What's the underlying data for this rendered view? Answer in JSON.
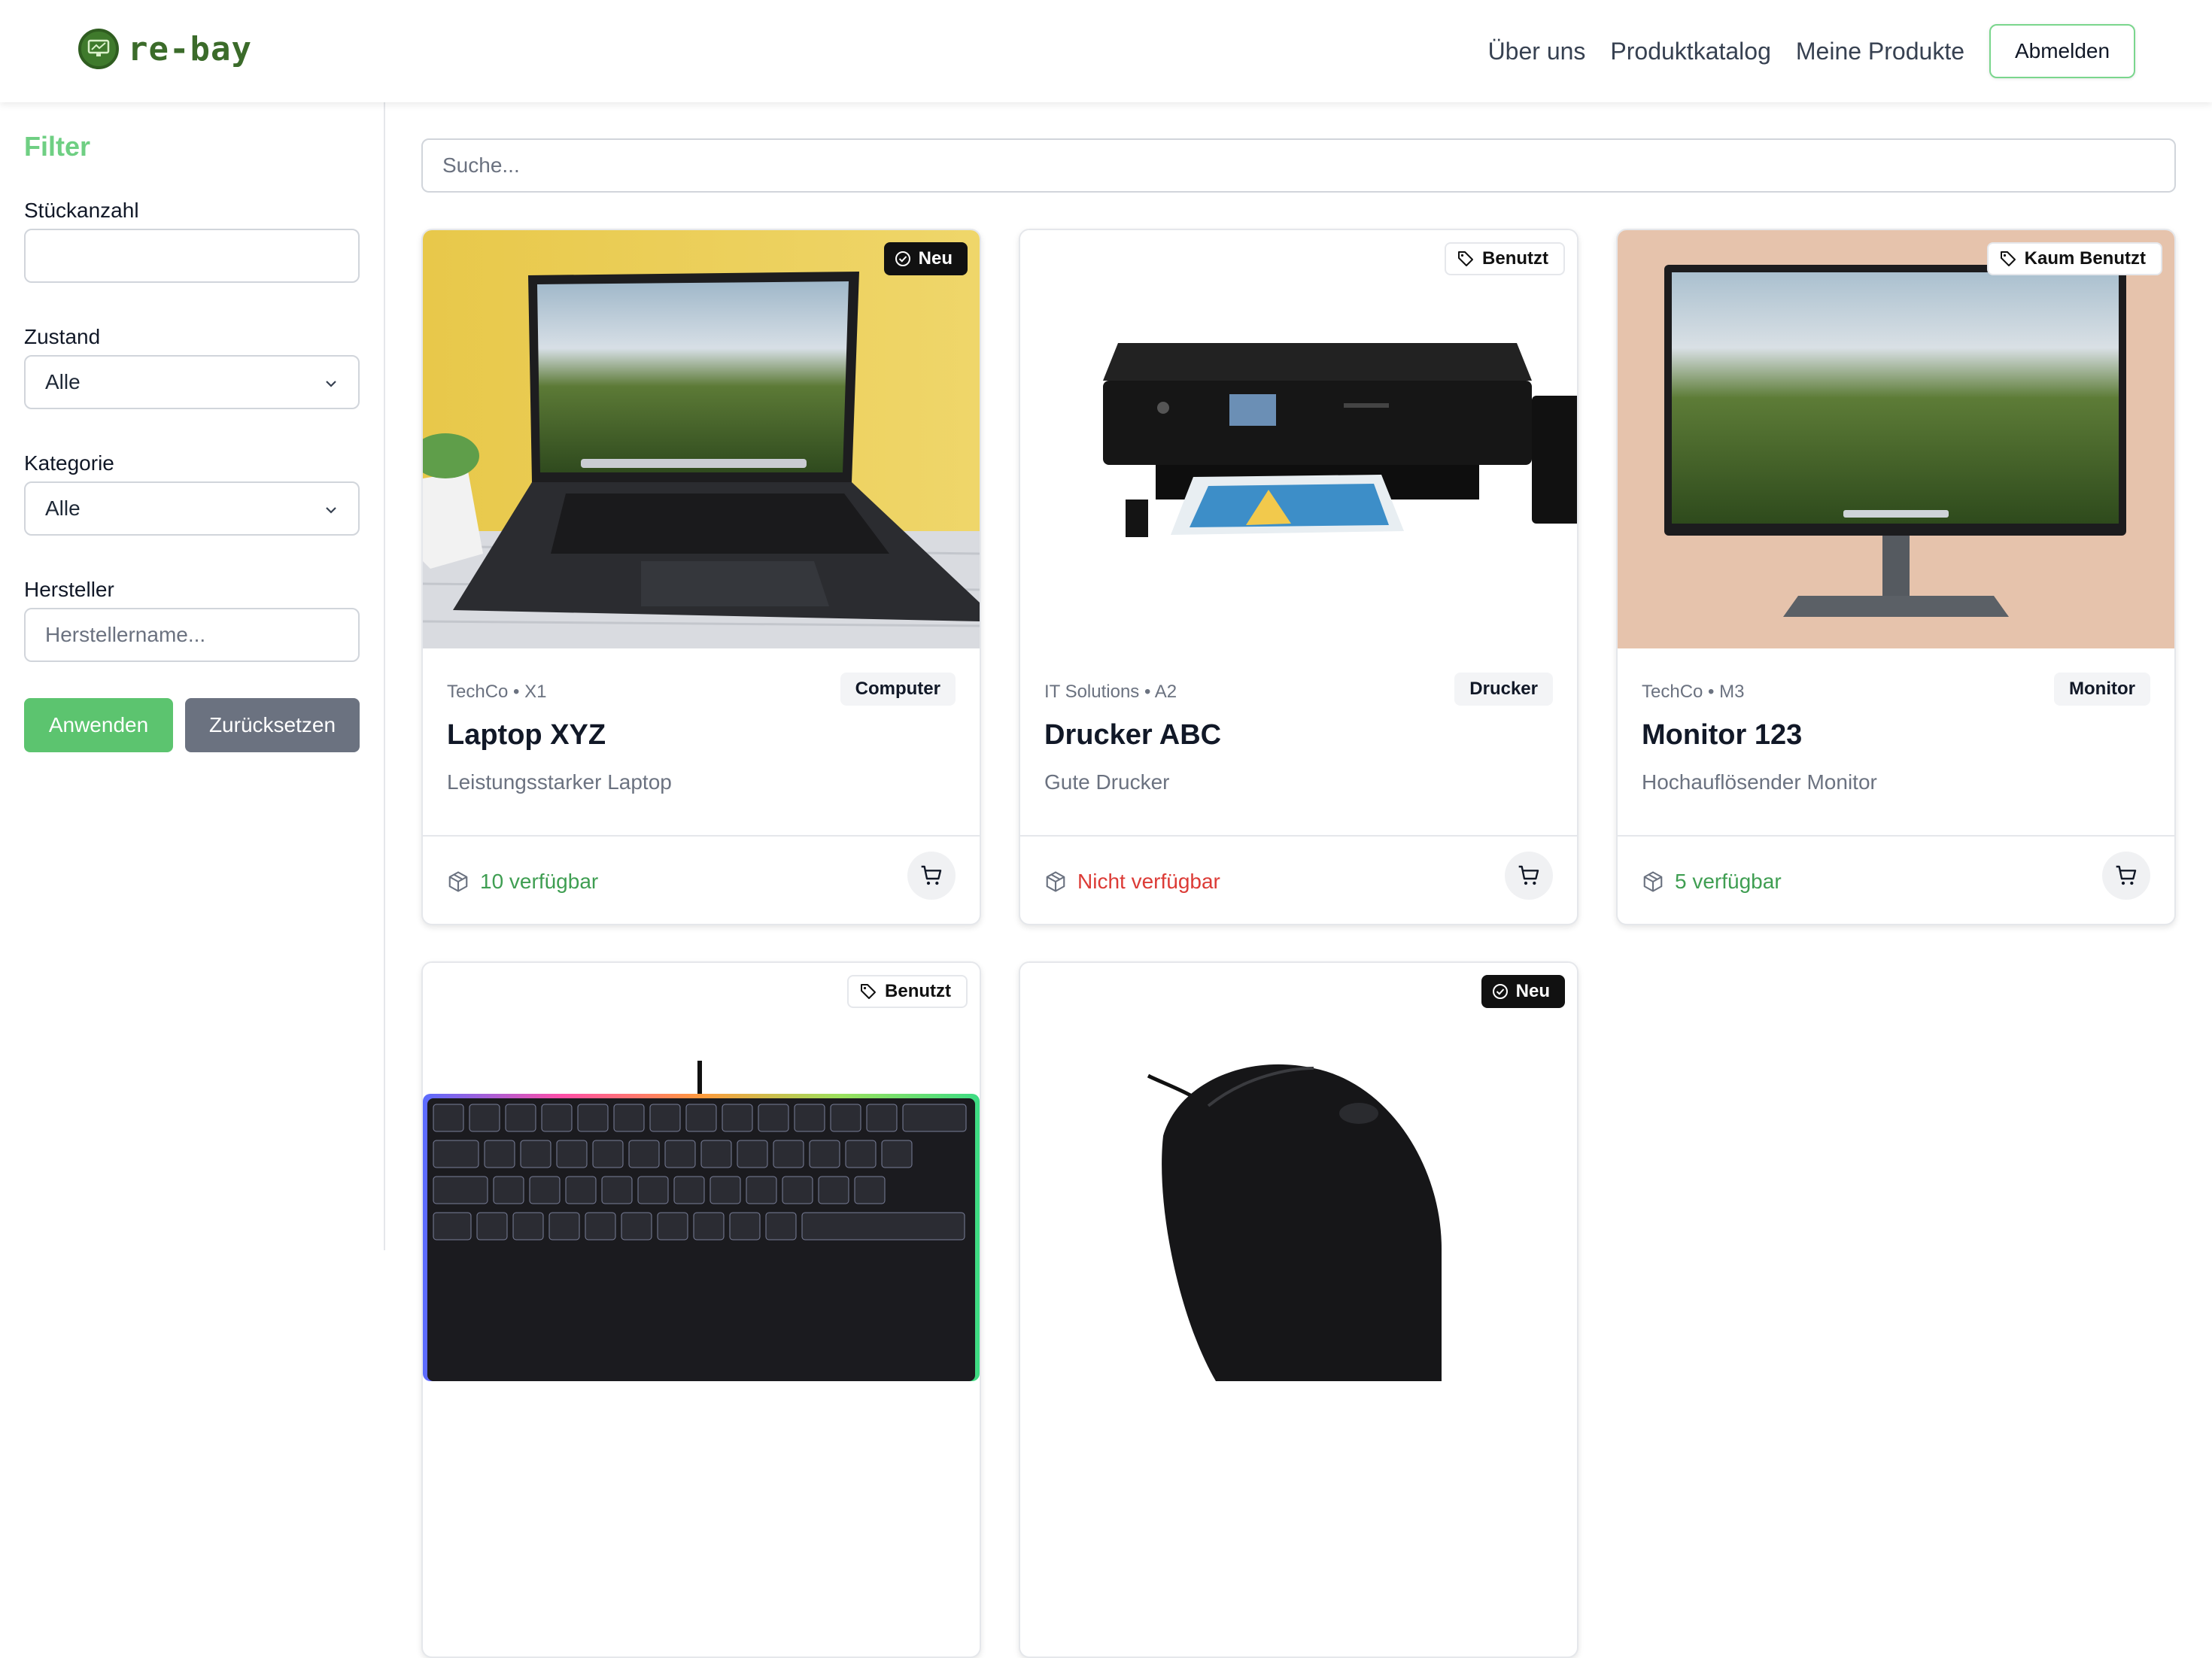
{
  "brand": {
    "name": "re-bay",
    "accent": "#6fcf83"
  },
  "nav": {
    "about": "Über uns",
    "catalog": "Produktkatalog",
    "my_products": "Meine Produkte",
    "logout": "Abmelden"
  },
  "filter": {
    "title": "Filter",
    "quantity_label": "Stückanzahl",
    "quantity_value": "",
    "condition_label": "Zustand",
    "condition_value": "Alle",
    "category_label": "Kategorie",
    "category_value": "Alle",
    "manufacturer_label": "Hersteller",
    "manufacturer_placeholder": "Herstellername...",
    "apply": "Anwenden",
    "reset": "Zurücksetzen"
  },
  "search": {
    "placeholder": "Suche..."
  },
  "products": [
    {
      "badge": "Neu",
      "badge_icon": "check-badge-icon",
      "vendor": "TechCo • X1",
      "category": "Computer",
      "name": "Laptop XYZ",
      "description": "Leistungsstarker Laptop",
      "availability": "10 verfügbar",
      "available": true
    },
    {
      "badge": "Benutzt",
      "badge_icon": "tag-icon",
      "vendor": "IT Solutions • A2",
      "category": "Drucker",
      "name": "Drucker ABC",
      "description": "Gute Drucker",
      "availability": "Nicht verfügbar",
      "available": false
    },
    {
      "badge": "Kaum Benutzt",
      "badge_icon": "tag-icon",
      "vendor": "TechCo • M3",
      "category": "Monitor",
      "name": "Monitor 123",
      "description": "Hochauflösender Monitor",
      "availability": "5 verfügbar",
      "available": true
    },
    {
      "badge": "Benutzt",
      "badge_icon": "tag-icon"
    },
    {
      "badge": "Neu",
      "badge_icon": "check-badge-icon"
    }
  ],
  "colors": {
    "available": "#3f9e52",
    "unavailable": "#dc3b36",
    "apply": "#5cc46f",
    "reset": "#6b7280"
  }
}
